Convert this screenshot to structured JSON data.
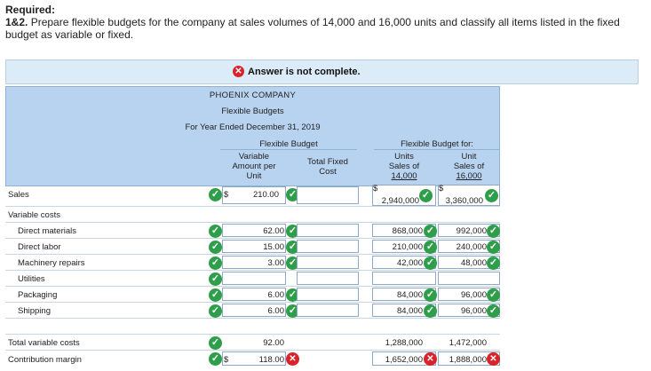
{
  "required": {
    "heading": "Required:",
    "part": "1&2.",
    "text": " Prepare flexible budgets for the company at sales volumes of 14,000 and 16,000 units and classify all items listed in the fixed budget as variable or fixed."
  },
  "banner": {
    "text": "Answer is not complete."
  },
  "table": {
    "company": "PHOENIX COMPANY",
    "title": "Flexible Budgets",
    "period": "For Year Ended December 31, 2019",
    "group_flexible": "Flexible Budget",
    "group_for": "Flexible Budget for:",
    "col_variable": [
      "Variable",
      "Amount per",
      "Unit"
    ],
    "col_fixed": [
      "Total Fixed",
      "Cost"
    ],
    "col_14": [
      "Units",
      "Sales of",
      "14,000"
    ],
    "col_16": [
      "Unit",
      "Sales of",
      "16,000"
    ],
    "currency": "$",
    "rows": {
      "sales": {
        "label": "Sales",
        "variable": "210.00",
        "u14": "2,940,000",
        "u16": "3,360,000"
      },
      "varcosts": {
        "label": "Variable costs"
      },
      "direct_materials": {
        "label": "Direct materials",
        "variable": "62.00",
        "u14": "868,000",
        "u16": "992,000"
      },
      "direct_labor": {
        "label": "Direct labor",
        "variable": "15.00",
        "u14": "210,000",
        "u16": "240,000"
      },
      "machinery": {
        "label": "Machinery repairs",
        "variable": "3.00",
        "u14": "42,000",
        "u16": "48,000"
      },
      "utilities": {
        "label": "Utilities"
      },
      "packaging": {
        "label": "Packaging",
        "variable": "6.00",
        "u14": "84,000",
        "u16": "96,000"
      },
      "shipping": {
        "label": "Shipping",
        "variable": "6.00",
        "u14": "84,000",
        "u16": "96,000"
      },
      "total_var": {
        "label": "Total variable costs",
        "variable": "92.00",
        "u14": "1,288,000",
        "u16": "1,472,000"
      },
      "contribution": {
        "label": "Contribution margin",
        "variable": "118.00",
        "u14": "1,652,000",
        "u16": "1,888,000"
      }
    }
  },
  "colors": {
    "header_bg": "#b7d3f0",
    "check": "#2e9e4a",
    "error": "#d9232a",
    "banner_bg": "#dcebf8"
  }
}
